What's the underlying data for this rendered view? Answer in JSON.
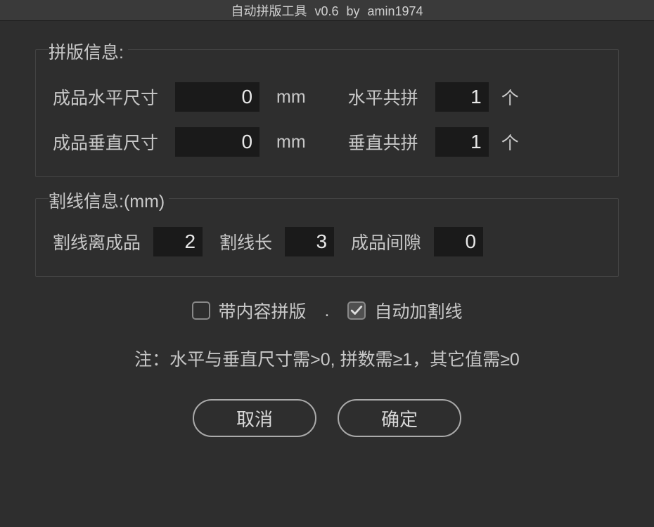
{
  "titlebar": "自动拼版工具 v0.6   by amin1974",
  "section1": {
    "title": "拼版信息:",
    "row1": {
      "label1": "成品水平尺寸",
      "value1": "0",
      "unit1": "mm",
      "label2": "水平共拼",
      "value2": "1",
      "unit2": "个"
    },
    "row2": {
      "label1": "成品垂直尺寸",
      "value1": "0",
      "unit1": "mm",
      "label2": "垂直共拼",
      "value2": "1",
      "unit2": "个"
    }
  },
  "section2": {
    "title": "割线信息:(mm)",
    "row1": {
      "label1": "割线离成品",
      "value1": "2",
      "label2": "割线长",
      "value2": "3",
      "label3": "成品间隙",
      "value3": "0"
    }
  },
  "checkboxes": {
    "cb1": {
      "label": "带内容拼版",
      "checked": false
    },
    "sep": ".",
    "cb2": {
      "label": "自动加割线",
      "checked": true
    }
  },
  "note": "注：水平与垂直尺寸需>0, 拼数需≥1，其它值需≥0",
  "buttons": {
    "cancel": "取消",
    "ok": "确定"
  }
}
